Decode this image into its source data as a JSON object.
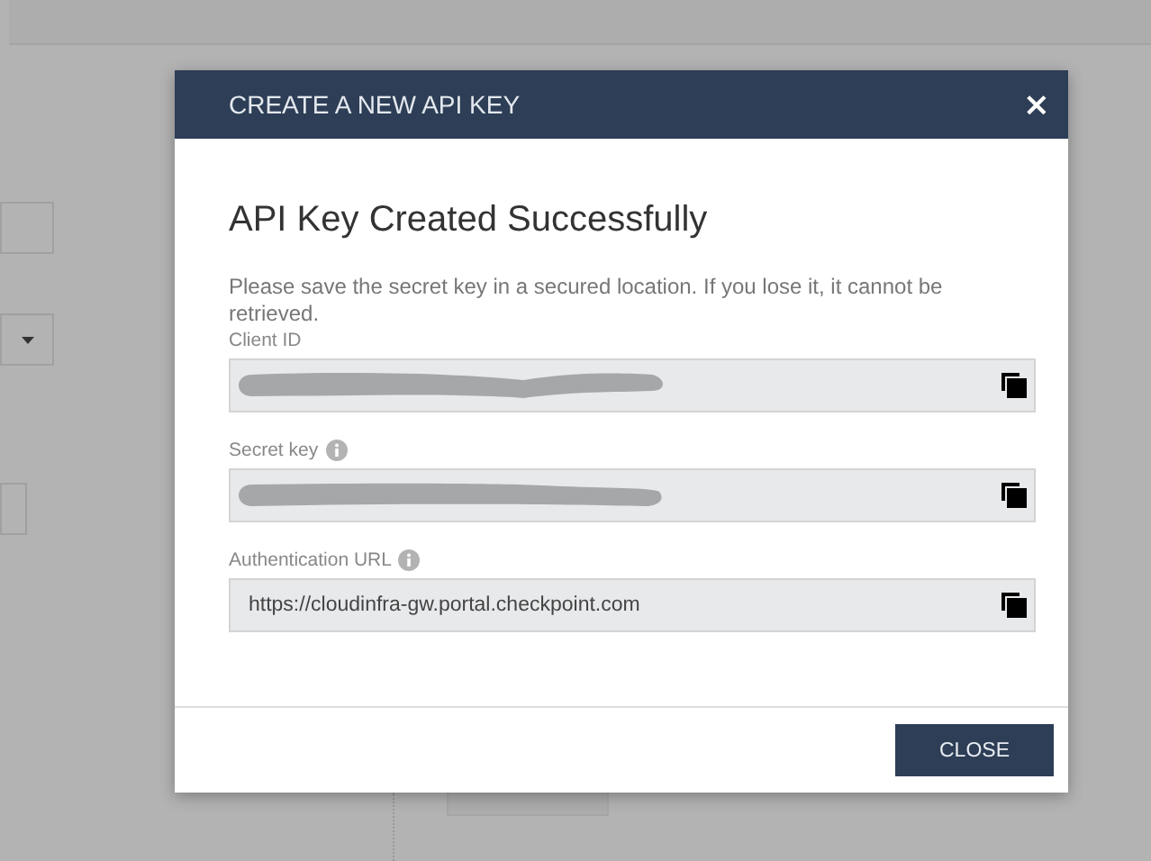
{
  "dialog": {
    "title": "CREATE A NEW API KEY",
    "close_icon": "×",
    "heading": "API Key Created Successfully",
    "message": "Please save the secret key in a secured location. If you lose it, it cannot be retrieved.",
    "fields": [
      {
        "label": "Client ID",
        "info": false,
        "kind": "redacted"
      },
      {
        "label": "Secret key",
        "info": true,
        "kind": "redacted"
      },
      {
        "label": "Authentication URL",
        "info": true,
        "kind": "text",
        "value": "https://cloudinfra-gw.portal.checkpoint.com"
      }
    ],
    "buttons": [
      "CLOSE"
    ]
  }
}
